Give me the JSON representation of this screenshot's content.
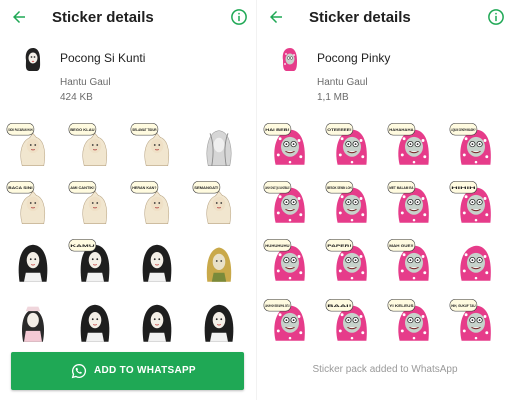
{
  "colors": {
    "accent": "#1fa855",
    "icon_green": "#1fa855",
    "pink": "#e63c8a",
    "text_secondary": "#6b6b6b"
  },
  "left": {
    "appbar": {
      "title": "Sticker details",
      "back_icon": "arrow-back-icon",
      "info_icon": "info-icon"
    },
    "pack": {
      "name": "Pocong Si Kunti",
      "publisher": "Hantu Gaul",
      "size": "424 KB"
    },
    "stickers": [
      {
        "kind": "beige",
        "bubble": "SIOK PACARAN HUH"
      },
      {
        "kind": "beige",
        "bubble": "BEGO KLAU"
      },
      {
        "kind": "beige",
        "bubble": "SELAMAT TIDUR"
      },
      {
        "kind": "gray",
        "bubble": ""
      },
      {
        "kind": "beige",
        "bubble": "BACA SINI"
      },
      {
        "kind": "beige",
        "bubble": "AMI CANTIK!"
      },
      {
        "kind": "beige",
        "bubble": "HERAN KAN?"
      },
      {
        "kind": "beige",
        "bubble": "SEMANGAT!"
      },
      {
        "kind": "hair",
        "bubble": ""
      },
      {
        "kind": "hair",
        "bubble": "KAMU"
      },
      {
        "kind": "hair",
        "bubble": ""
      },
      {
        "kind": "blond",
        "bubble": ""
      },
      {
        "kind": "nurse",
        "bubble": ""
      },
      {
        "kind": "hair",
        "bubble": ""
      },
      {
        "kind": "hair",
        "bubble": ""
      },
      {
        "kind": "hair",
        "bubble": ""
      }
    ],
    "button": {
      "label": "ADD TO WHATSAPP",
      "icon": "whatsapp-icon"
    }
  },
  "right": {
    "appbar": {
      "title": "Sticker details",
      "back_icon": "arrow-back-icon",
      "info_icon": "info-icon"
    },
    "pack": {
      "name": "Pocong Pinky",
      "publisher": "Hantu Gaul",
      "size": "1,1 MB"
    },
    "stickers": [
      {
        "kind": "pinky",
        "bubble": "HAI BEB!"
      },
      {
        "kind": "pinky",
        "bubble": "OTEEEEE!"
      },
      {
        "kind": "pinky",
        "bubble": "HAHAHAHA"
      },
      {
        "kind": "pinky",
        "bubble": "AQUIN CEKEH MASIH?"
      },
      {
        "kind": "pinky",
        "bubble": "AHUH CHAT QU GA KEBALE"
      },
      {
        "kind": "pinky",
        "bubble": "BESOK SENIN LOH"
      },
      {
        "kind": "pinky",
        "bubble": "MET MALAM EA"
      },
      {
        "kind": "pinky",
        "bubble": "HIHIH"
      },
      {
        "kind": "pinky",
        "bubble": "HUHUHUHU"
      },
      {
        "kind": "pinky",
        "bubble": "PAPER!"
      },
      {
        "kind": "pinky",
        "bubble": "MAH GUE!!"
      },
      {
        "kind": "pinky",
        "bubble": ""
      },
      {
        "kind": "pinky",
        "bubble": "AHUH KIH SEKAPHIL GITU"
      },
      {
        "kind": "pinky",
        "bubble": "BAAI!"
      },
      {
        "kind": "pinky",
        "bubble": "YI KELEUS"
      },
      {
        "kind": "pinky",
        "bubble": "HIH, GUKUF TAU"
      }
    ],
    "status": "Sticker pack added to WhatsApp"
  }
}
